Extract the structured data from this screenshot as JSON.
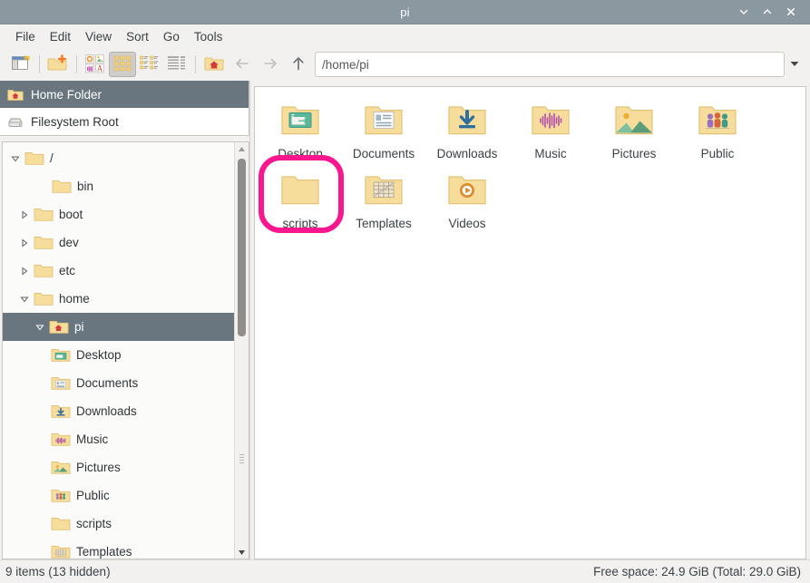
{
  "window": {
    "title": "pi",
    "controls": [
      {
        "name": "minimize-button",
        "glyph": "chevron-down"
      },
      {
        "name": "maximize-button",
        "glyph": "chevron-up"
      },
      {
        "name": "close-button",
        "glyph": "x"
      }
    ]
  },
  "menubar": {
    "items": [
      {
        "label": "File"
      },
      {
        "label": "Edit"
      },
      {
        "label": "View"
      },
      {
        "label": "Sort"
      },
      {
        "label": "Go"
      },
      {
        "label": "Tools"
      }
    ]
  },
  "toolbar": {
    "buttons": [
      {
        "name": "new-window-button",
        "icon": "new-window-icon",
        "active": false
      },
      {
        "name": "new-folder-button",
        "icon": "new-folder-icon",
        "active": false
      },
      {
        "name": "show-thumbnails-button",
        "icon": "thumbnails-icon",
        "active": false
      },
      {
        "name": "icon-view-button",
        "icon": "icon-view-icon",
        "active": true
      },
      {
        "name": "compact-view-button",
        "icon": "compact-view-icon",
        "active": false
      },
      {
        "name": "detailed-list-view-button",
        "icon": "list-view-icon",
        "active": false
      },
      {
        "name": "home-button",
        "icon": "home-folder-icon",
        "active": false
      }
    ],
    "nav": [
      {
        "name": "back-button",
        "icon": "arrow-left-icon",
        "enabled": false
      },
      {
        "name": "forward-button",
        "icon": "arrow-right-icon",
        "enabled": false
      },
      {
        "name": "up-button",
        "icon": "arrow-up-icon",
        "enabled": true
      }
    ],
    "path_value": "/home/pi",
    "path_placeholder": "/home/pi",
    "dropdown_icon": "chevron-down-icon"
  },
  "sidebar": {
    "places": [
      {
        "label": "Home Folder",
        "icon": "home-folder-icon",
        "selected": true
      },
      {
        "label": "Filesystem Root",
        "icon": "drive-icon",
        "selected": false
      }
    ],
    "tree": [
      {
        "label": "/",
        "icon": "folder-icon",
        "indent": 0,
        "twisty": "open",
        "selected": false
      },
      {
        "label": "bin",
        "icon": "folder-icon",
        "indent": 1,
        "twisty": "none",
        "selected": false
      },
      {
        "label": "boot",
        "icon": "folder-icon",
        "indent": 1,
        "twisty": "closed",
        "selected": false
      },
      {
        "label": "dev",
        "icon": "folder-icon",
        "indent": 1,
        "twisty": "closed",
        "selected": false
      },
      {
        "label": "etc",
        "icon": "folder-icon",
        "indent": 1,
        "twisty": "closed",
        "selected": false
      },
      {
        "label": "home",
        "icon": "folder-icon",
        "indent": 1,
        "twisty": "open",
        "selected": false
      },
      {
        "label": "pi",
        "icon": "folder-home-icon",
        "indent": 2,
        "twisty": "open",
        "selected": true
      },
      {
        "label": "Desktop",
        "icon": "folder-desktop-icon",
        "indent": 3,
        "twisty": "none",
        "selected": false
      },
      {
        "label": "Documents",
        "icon": "folder-documents-icon",
        "indent": 3,
        "twisty": "none",
        "selected": false
      },
      {
        "label": "Downloads",
        "icon": "folder-downloads-icon",
        "indent": 3,
        "twisty": "none",
        "selected": false
      },
      {
        "label": "Music",
        "icon": "folder-music-icon",
        "indent": 3,
        "twisty": "none",
        "selected": false
      },
      {
        "label": "Pictures",
        "icon": "folder-pictures-icon",
        "indent": 3,
        "twisty": "none",
        "selected": false
      },
      {
        "label": "Public",
        "icon": "folder-public-icon",
        "indent": 3,
        "twisty": "none",
        "selected": false
      },
      {
        "label": "scripts",
        "icon": "folder-icon",
        "indent": 3,
        "twisty": "none",
        "selected": false
      },
      {
        "label": "Templates",
        "icon": "folder-templates-icon",
        "indent": 3,
        "twisty": "none",
        "selected": false
      }
    ]
  },
  "main": {
    "files": [
      {
        "label": "Desktop",
        "icon": "folder-desktop-icon",
        "highlighted": false
      },
      {
        "label": "Documents",
        "icon": "folder-documents-icon",
        "highlighted": false
      },
      {
        "label": "Downloads",
        "icon": "folder-downloads-icon",
        "highlighted": false
      },
      {
        "label": "Music",
        "icon": "folder-music-icon",
        "highlighted": false
      },
      {
        "label": "Pictures",
        "icon": "folder-pictures-icon",
        "highlighted": false
      },
      {
        "label": "Public",
        "icon": "folder-public-icon",
        "highlighted": false
      },
      {
        "label": "scripts",
        "icon": "folder-icon",
        "highlighted": true
      },
      {
        "label": "Templates",
        "icon": "folder-templates-icon",
        "highlighted": false
      },
      {
        "label": "Videos",
        "icon": "folder-videos-icon",
        "highlighted": false
      }
    ],
    "highlight_color": "#f8178f"
  },
  "statusbar": {
    "left": "9 items (13 hidden)",
    "right": "Free space: 24.9 GiB (Total: 29.0 GiB)"
  }
}
